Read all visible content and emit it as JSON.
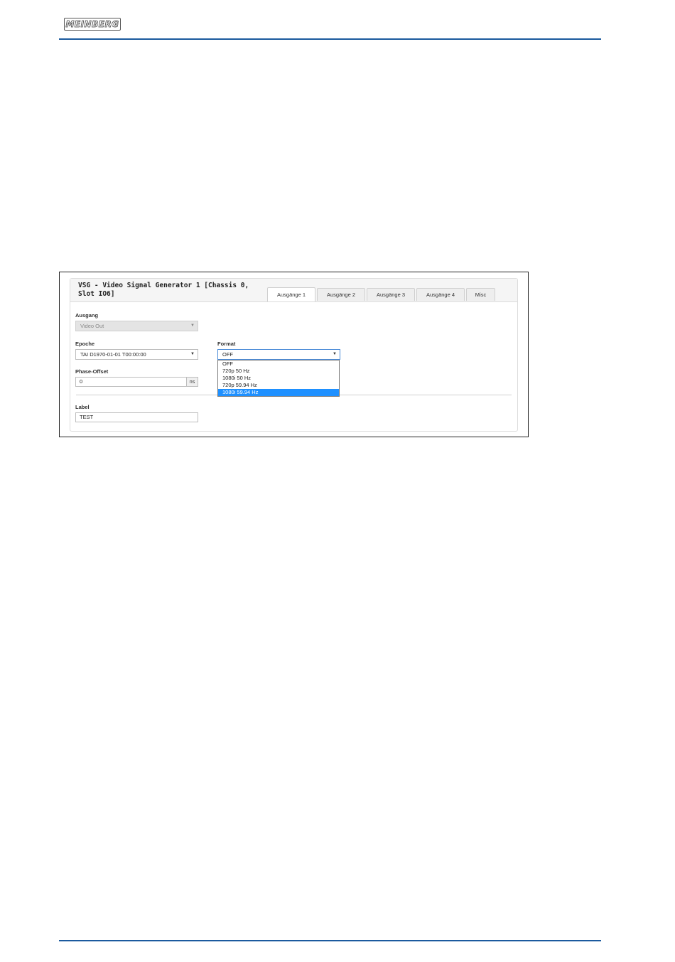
{
  "header": {
    "logo_text": "MEINBERG"
  },
  "colors": {
    "rule": "#1b5a9e",
    "highlight": "#1e90ff"
  },
  "panel": {
    "title": "VSG - Video Signal Generator 1 [Chassis 0, Slot IO6]",
    "tabs": [
      "Ausgänge 1",
      "Ausgänge 2",
      "Ausgänge 3",
      "Ausgänge 4",
      "Misc"
    ],
    "active_tab": "Ausgänge 1"
  },
  "form": {
    "ausgang": {
      "label": "Ausgang",
      "value": "Video Out",
      "disabled": true
    },
    "epoche": {
      "label": "Epoche",
      "value": "TAI D1970-01-01 T00:00:00"
    },
    "format": {
      "label": "Format",
      "value": "OFF",
      "options": [
        "OFF",
        "720p 50 Hz",
        "1080i 50 Hz",
        "720p 59.94 Hz",
        "1080i 59.94 Hz"
      ],
      "highlighted": "1080i 59.94 Hz"
    },
    "phase_offset": {
      "label": "Phase-Offset",
      "value": "0",
      "unit": "ns"
    },
    "label": {
      "label": "Label",
      "value": "TEST"
    }
  }
}
